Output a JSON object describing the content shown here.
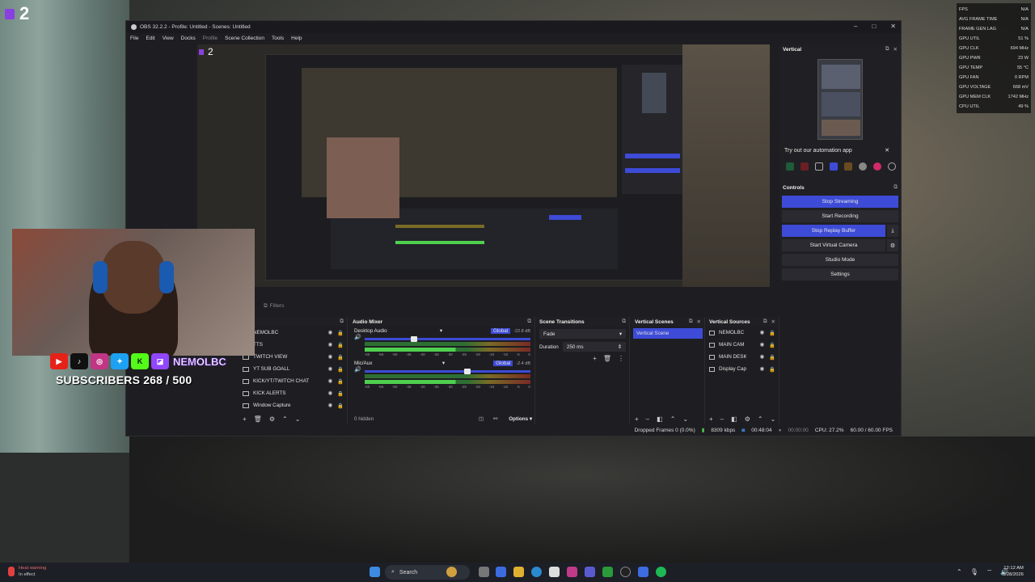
{
  "overlay": {
    "twitch_count": "2",
    "social_name": "NEMOLBC",
    "subscribers": "SUBSCRIBERS 268 / 500",
    "social_icons": [
      "youtube-icon",
      "tiktok-icon",
      "instagram-icon",
      "twitter-icon",
      "kick-icon",
      "twitch-icon"
    ]
  },
  "window": {
    "title": "OBS 32.2.2 - Profile: Untitled - Scenes: Untitled",
    "menu": [
      "File",
      "Edit",
      "View",
      "Docks",
      "Profile",
      "Scene Collection",
      "Tools",
      "Help"
    ],
    "preview_count": "2"
  },
  "vertical": {
    "title": "Vertical",
    "automation_text": "Try out our automation app"
  },
  "controls": {
    "title": "Controls",
    "buttons": [
      "Stop Streaming",
      "Start Recording",
      "Stop Replay Buffer",
      "Start Virtual Camera",
      "Studio Mode",
      "Settings"
    ]
  },
  "filters_label": "Filters",
  "sources": {
    "title": "rces",
    "items": [
      "NEMOLBC",
      "TTS",
      "TWITCH VIEW",
      "YT SUB GOALL",
      "KICK/YT/TWITCH CHAT",
      "KICK ALERTS",
      "Window Capture"
    ]
  },
  "mixer": {
    "title": "Audio Mixer",
    "tracks": [
      {
        "name": "Desktop Audio",
        "mode": "Global",
        "db": "-22.8 dB",
        "level": 0.28
      },
      {
        "name": "Mic/Aux",
        "mode": "Global",
        "db": "-2.4 dB",
        "level": 0.6
      }
    ],
    "scale": [
      "-60",
      "-55",
      "-50",
      "-45",
      "-40",
      "-35",
      "-30",
      "-25",
      "-20",
      "-15",
      "-10",
      "-5",
      "0"
    ],
    "hidden": "0 hidden",
    "options": "Options"
  },
  "transitions": {
    "title": "Scene Transitions",
    "type": "Fade",
    "duration_label": "Duration",
    "duration": "250 ms"
  },
  "vscenes": {
    "title": "Vertical Scenes",
    "items": [
      "Vertical Scene"
    ]
  },
  "vsources": {
    "title": "Vertical Sources",
    "items": [
      "NEMOLBC",
      "MAIN CAM",
      "MAIN DESK",
      "Display Cap"
    ]
  },
  "status": {
    "dropped": "Dropped Frames 0 (0.0%)",
    "kbps": "8309 kbps",
    "stream_time": "00:48:04",
    "rec_time": "00:00:00",
    "cpu": "CPU: 27.2%",
    "fps": "60.00 / 60.00 FPS"
  },
  "perf": [
    {
      "k": "FPS",
      "v": "N/A"
    },
    {
      "k": "AVG FRAME TIME",
      "v": "N/A"
    },
    {
      "k": "FRAME GEN LAG",
      "v": "N/A"
    },
    {
      "k": "GPU UTIL",
      "v": "51 %"
    },
    {
      "k": "GPU CLK",
      "v": "694 MHz"
    },
    {
      "k": "GPU PWR",
      "v": "23 W"
    },
    {
      "k": "GPU TEMP",
      "v": "55 °C"
    },
    {
      "k": "GPU FAN",
      "v": "0 RPM"
    },
    {
      "k": "GPU VOLTAGE",
      "v": "668 mV"
    },
    {
      "k": "GPU MEM CLK",
      "v": "1742 MHz"
    },
    {
      "k": "CPU UTIL",
      "v": "49 %"
    }
  ],
  "taskbar": {
    "heat_title": "Heat warning",
    "heat_sub": "In effect",
    "search": "Search",
    "time": "12:12 AM",
    "date": "6/28/2026"
  }
}
